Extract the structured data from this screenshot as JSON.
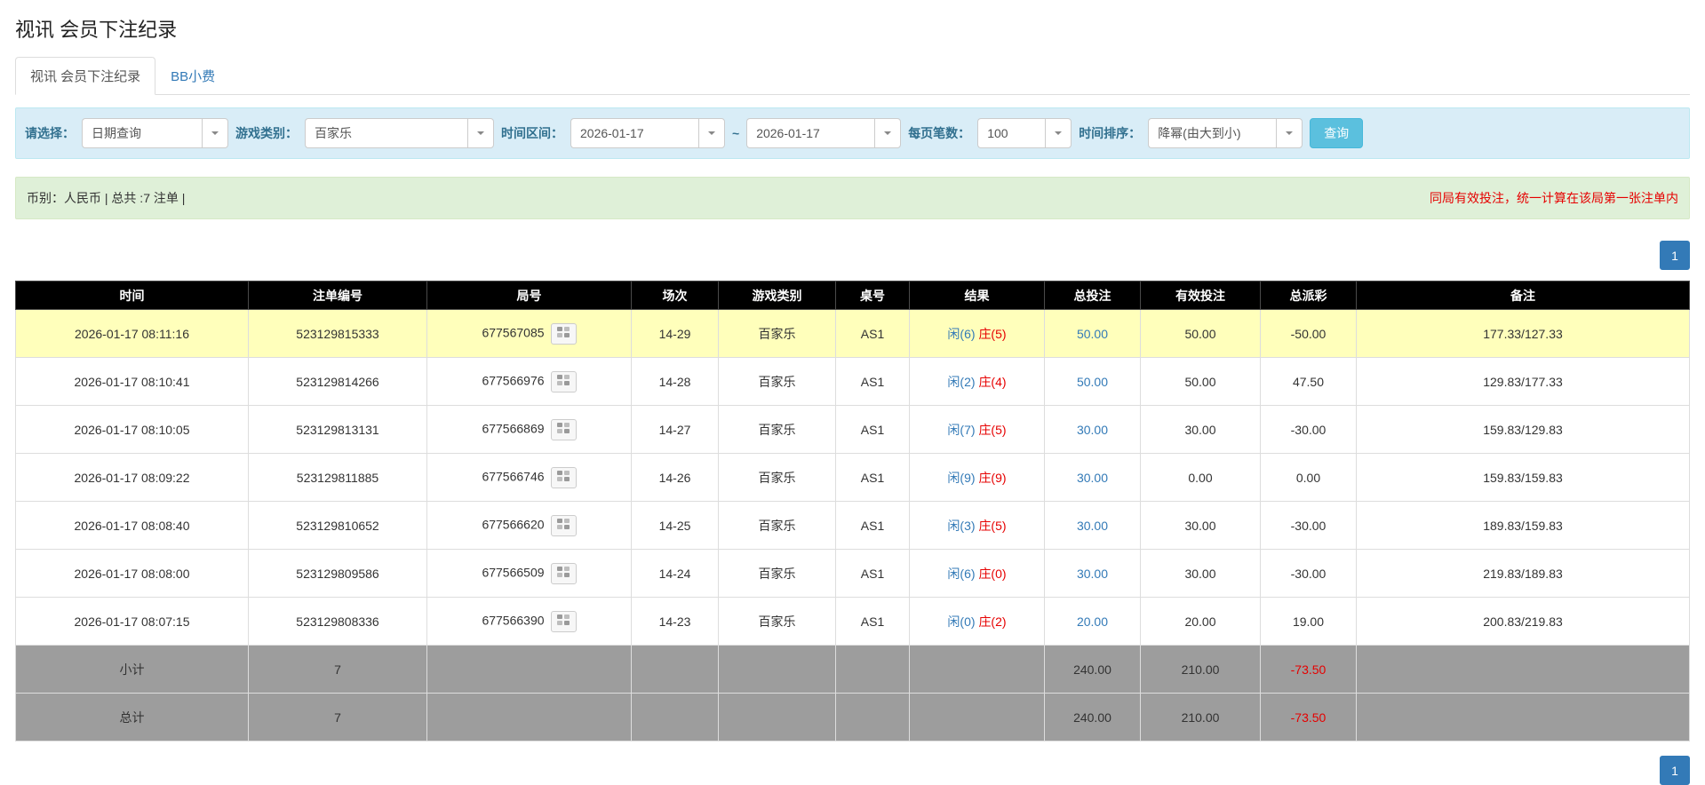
{
  "page_title": "视讯 会员下注纪录",
  "tabs": [
    {
      "label": "视讯 会员下注纪录",
      "active": true
    },
    {
      "label": "BB小费",
      "active": false
    }
  ],
  "filters": {
    "select": {
      "label": "请选择：",
      "value": "日期查询"
    },
    "game_type": {
      "label": "游戏类别：",
      "value": "百家乐"
    },
    "date_range": {
      "label": "时间区间：",
      "from": "2026-01-17",
      "separator": "~",
      "to": "2026-01-17"
    },
    "page_size": {
      "label": "每页笔数：",
      "value": "100"
    },
    "sort": {
      "label": "时间排序：",
      "value": "降幂(由大到小)"
    },
    "search_button": "查询"
  },
  "summary": {
    "left": "币别：人民币 | 总共 :7 注单 |",
    "note": "同局有效投注，统一计算在该局第一张注单内"
  },
  "pagination": {
    "top": "1",
    "bottom": "1"
  },
  "table": {
    "headers": [
      "时间",
      "注单编号",
      "局号",
      "场次",
      "游戏类别",
      "桌号",
      "结果",
      "总投注",
      "有效投注",
      "总派彩",
      "备注"
    ],
    "rows": [
      {
        "time": "2026-01-17 08:11:16",
        "bet_no": "523129815333",
        "round_no": "677567085",
        "session": "14-29",
        "game": "百家乐",
        "table": "AS1",
        "player": "闲(6)",
        "banker": "庄(5)",
        "total_bet": "50.00",
        "valid_bet": "50.00",
        "payout": "-50.00",
        "payout_negative": true,
        "note": "177.33/127.33",
        "highlighted": true
      },
      {
        "time": "2026-01-17 08:10:41",
        "bet_no": "523129814266",
        "round_no": "677566976",
        "session": "14-28",
        "game": "百家乐",
        "table": "AS1",
        "player": "闲(2)",
        "banker": "庄(4)",
        "total_bet": "50.00",
        "valid_bet": "50.00",
        "payout": "47.50",
        "payout_negative": false,
        "note": "129.83/177.33",
        "highlighted": false
      },
      {
        "time": "2026-01-17 08:10:05",
        "bet_no": "523129813131",
        "round_no": "677566869",
        "session": "14-27",
        "game": "百家乐",
        "table": "AS1",
        "player": "闲(7)",
        "banker": "庄(5)",
        "total_bet": "30.00",
        "valid_bet": "30.00",
        "payout": "-30.00",
        "payout_negative": true,
        "note": "159.83/129.83",
        "highlighted": false
      },
      {
        "time": "2026-01-17 08:09:22",
        "bet_no": "523129811885",
        "round_no": "677566746",
        "session": "14-26",
        "game": "百家乐",
        "table": "AS1",
        "player": "闲(9)",
        "banker": "庄(9)",
        "total_bet": "30.00",
        "valid_bet": "0.00",
        "payout": "0.00",
        "payout_negative": false,
        "note": "159.83/159.83",
        "highlighted": false
      },
      {
        "time": "2026-01-17 08:08:40",
        "bet_no": "523129810652",
        "round_no": "677566620",
        "session": "14-25",
        "game": "百家乐",
        "table": "AS1",
        "player": "闲(3)",
        "banker": "庄(5)",
        "total_bet": "30.00",
        "valid_bet": "30.00",
        "payout": "-30.00",
        "payout_negative": true,
        "note": "189.83/159.83",
        "highlighted": false
      },
      {
        "time": "2026-01-17 08:08:00",
        "bet_no": "523129809586",
        "round_no": "677566509",
        "session": "14-24",
        "game": "百家乐",
        "table": "AS1",
        "player": "闲(6)",
        "banker": "庄(0)",
        "total_bet": "30.00",
        "valid_bet": "30.00",
        "payout": "-30.00",
        "payout_negative": true,
        "note": "219.83/189.83",
        "highlighted": false
      },
      {
        "time": "2026-01-17 08:07:15",
        "bet_no": "523129808336",
        "round_no": "677566390",
        "session": "14-23",
        "game": "百家乐",
        "table": "AS1",
        "player": "闲(0)",
        "banker": "庄(2)",
        "total_bet": "20.00",
        "valid_bet": "20.00",
        "payout": "19.00",
        "payout_negative": false,
        "note": "200.83/219.83",
        "highlighted": false
      }
    ],
    "footer_rows": [
      {
        "label": "小计",
        "count": "7",
        "total_bet": "240.00",
        "valid_bet": "210.00",
        "payout": "-73.50",
        "payout_negative": true
      },
      {
        "label": "总计",
        "count": "7",
        "total_bet": "240.00",
        "valid_bet": "210.00",
        "payout": "-73.50",
        "payout_negative": true
      }
    ]
  },
  "colors": {
    "accent_blue": "#337ab7",
    "negative_red": "#e60000",
    "player_blue": "#337ab7",
    "banker_red": "#e60000",
    "highlight_yellow": "#ffffbb",
    "header_black": "#000000",
    "footer_gray": "#9d9d9d",
    "filter_bar_blue": "#d9edf7",
    "summary_bar_green": "#dff0d8",
    "search_button_blue": "#5bc0de"
  }
}
